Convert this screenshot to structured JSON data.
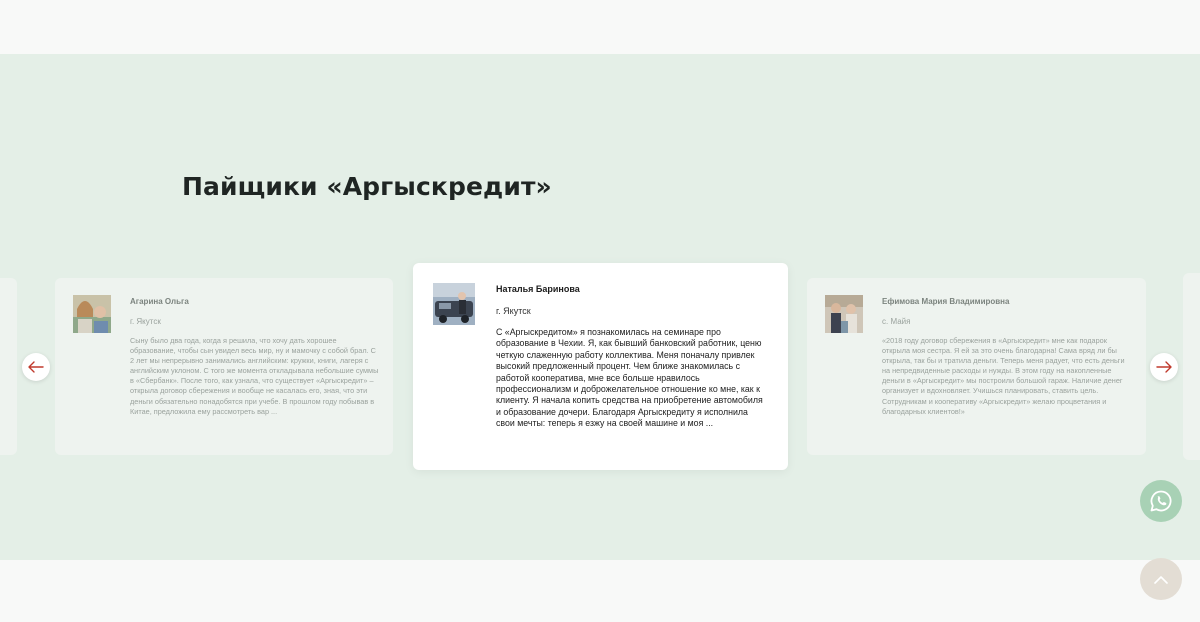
{
  "section": {
    "title": "Пайщики «Аргыскредит»"
  },
  "reviews": [
    {
      "name": "Агарина Ольга",
      "city": "г. Якутск",
      "text": "Сыну было два года, когда я решила, что хочу дать хорошее образование, чтобы сын увидел весь мир, ну и мамочку с собой брал. С 2 лет мы непрерывно занимались английским: кружки, книги, лагеря с английским уклоном. С того же момента откладывала небольшие суммы в «Сбербанк». После того, как узнала, что существует «Аргыскредит» – открыла договор сбережения и вообще не касалась его, зная, что эти деньги обязательно понадобятся при учебе. В прошлом году побывав в Китае, предложила ему рассмотреть вар ..."
    },
    {
      "name": "Наталья Баринова",
      "city": "г. Якутск",
      "text": "С «Аргыскредитом» я познакомилась на семинаре про образование в Чехии. Я, как бывший банковский работник, ценю четкую слаженную работу коллектива. Меня поначалу привлек высокий предложенный процент. Чем ближе знакомилась с работой кооператива, мне все больше нравилось профессионализм и доброжелательное отношение ко мне, как к клиенту. Я начала копить средства на приобретение автомобиля и образование дочери. Благодаря Аргыскредиту я исполнила свои мечты: теперь я езжу на своей машине и моя ..."
    },
    {
      "name": "Ефимова Мария Владимировна",
      "city": "с. Майя",
      "text": "«2018 году договор сбережения в «Аргыскредит» мне как подарок открыла моя сестра. Я ей за это очень благодарна! Сама вряд ли бы открыла, так бы и тратила деньги. Теперь меня радует, что есть деньги на непредвиденные расходы и нужды. В этом году на накопленные деньги в «Аргыскредит» мы построили большой гараж. Наличие денег организует и вдохновляет. Учишься планировать, ставить цель. Сотрудникам и кооперативу «Аргыскредит» желаю процветания и благодарных клиентов!»"
    }
  ],
  "icons": {
    "prev": "arrow-left-icon",
    "next": "arrow-right-icon",
    "chat": "whatsapp-icon",
    "up": "chevron-up-icon"
  },
  "colors": {
    "section_bg": "#e4efe7",
    "arrow_accent": "#c0392b",
    "chat_bg": "#a8d1b5",
    "up_bg": "#e3ddd4"
  }
}
